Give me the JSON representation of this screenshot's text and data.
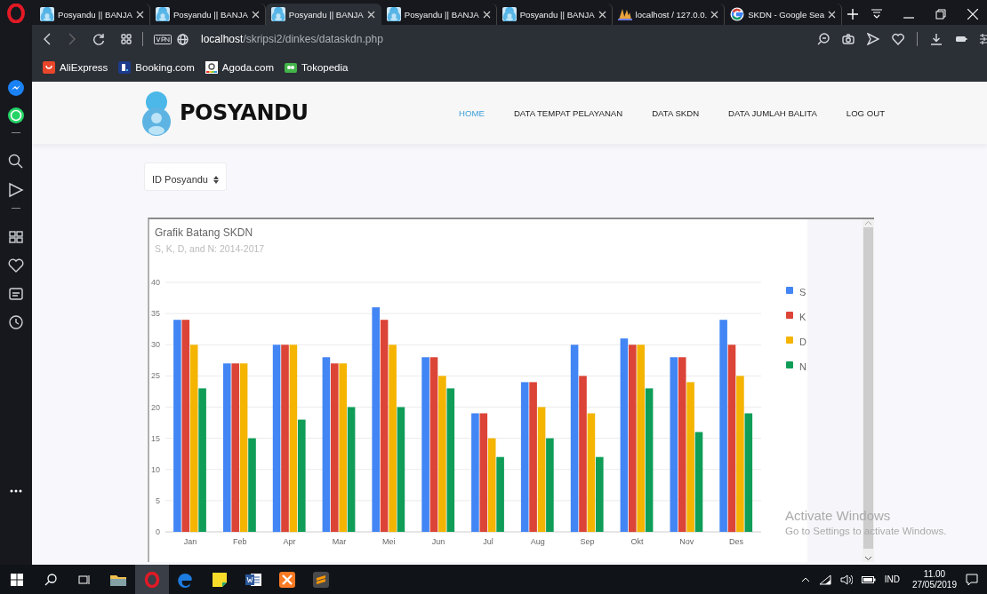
{
  "browser": {
    "tabs": [
      {
        "title": "Posyandu || BANJA",
        "kind": "site",
        "selected": false
      },
      {
        "title": "Posyandu || BANJA",
        "kind": "site",
        "selected": false
      },
      {
        "title": "Posyandu || BANJA",
        "kind": "site",
        "selected": true
      },
      {
        "title": "Posyandu || BANJA",
        "kind": "site",
        "selected": false
      },
      {
        "title": "Posyandu || BANJA",
        "kind": "site",
        "selected": false
      },
      {
        "title": "localhost / 127.0.0.",
        "kind": "database",
        "selected": false
      },
      {
        "title": "SKDN - Google Sea",
        "kind": "search",
        "selected": false
      }
    ],
    "address": {
      "host": "localhost",
      "path": "/skripsi2/dinkes/dataskdn.php"
    },
    "bookmarks": [
      {
        "label": "AliExpress"
      },
      {
        "label": "Booking.com"
      },
      {
        "label": "Agoda.com"
      },
      {
        "label": "Tokopedia"
      }
    ]
  },
  "site": {
    "brand": "POSYANDU",
    "nav": [
      {
        "label": "HOME",
        "selected": true
      },
      {
        "label": "DATA TEMPAT PELAYANAN",
        "selected": false
      },
      {
        "label": "DATA SKDN",
        "selected": false
      },
      {
        "label": "DATA JUMLAH BALITA",
        "selected": false
      },
      {
        "label": "LOG OUT",
        "selected": false
      }
    ]
  },
  "filter": {
    "label": "ID Posyandu"
  },
  "chart_panel": {
    "subtitle": "S, K, D, and N: 2014-2017",
    "chart_data": {
      "type": "bar",
      "title": "Grafik Batang SKDN",
      "categories": [
        "Jan",
        "Feb",
        "Apr",
        "Mar",
        "Mei",
        "Jun",
        "Jul",
        "Aug",
        "Sep",
        "Okt",
        "Nov",
        "Des"
      ],
      "series": [
        {
          "name": "S",
          "color": "#4285f4",
          "values": [
            34,
            27,
            30,
            28,
            36,
            28,
            19,
            24,
            30,
            31,
            28,
            34
          ]
        },
        {
          "name": "K",
          "color": "#db4437",
          "values": [
            34,
            27,
            30,
            27,
            34,
            28,
            19,
            24,
            25,
            30,
            28,
            30
          ]
        },
        {
          "name": "D",
          "color": "#f4b400",
          "values": [
            30,
            27,
            30,
            27,
            30,
            25,
            15,
            20,
            19,
            30,
            24,
            25
          ]
        },
        {
          "name": "N",
          "color": "#0f9d58",
          "values": [
            23,
            15,
            18,
            20,
            20,
            23,
            12,
            15,
            12,
            23,
            16,
            19
          ]
        }
      ],
      "grid": true,
      "legend": "right",
      "ylim": [
        0,
        40
      ],
      "yticks": [
        0,
        5,
        10,
        15,
        20,
        25,
        30,
        35,
        40
      ]
    }
  },
  "os_notice": {
    "title": "Activate Windows",
    "text": "Go to Settings to activate Windows."
  },
  "taskbar": {
    "language": "IND",
    "time": "11.00",
    "date": "27/05/2019"
  }
}
